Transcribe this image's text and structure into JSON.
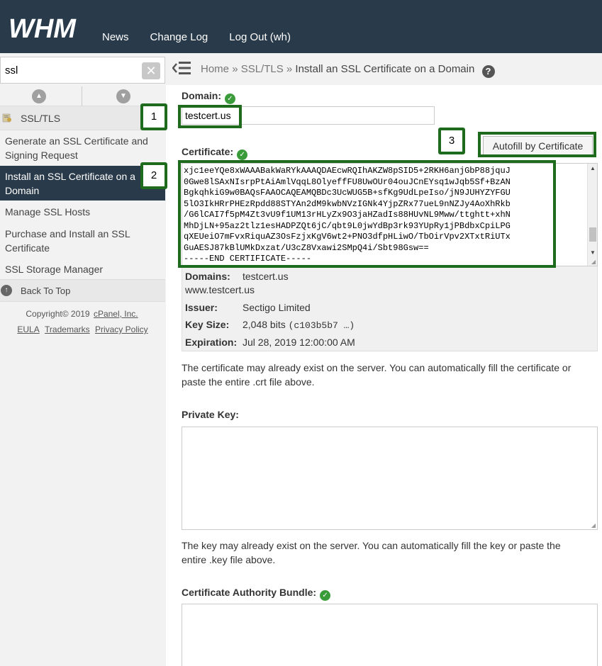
{
  "header": {
    "logo_text": "WHM",
    "nav": [
      "News",
      "Change Log",
      "Log Out (wh)"
    ]
  },
  "sidebar": {
    "search_value": "ssl",
    "category": "SSL/TLS",
    "items": [
      {
        "label": "Generate an SSL Certificate and Signing Request",
        "active": false
      },
      {
        "label": "Install an SSL Certificate on a Domain",
        "active": true
      },
      {
        "label": "Manage SSL Hosts",
        "active": false
      },
      {
        "label": "Purchase and Install an SSL Certificate",
        "active": false
      },
      {
        "label": "SSL Storage Manager",
        "active": false
      }
    ],
    "back_to_top": "Back To Top",
    "copyright_prefix": "Copyright© 2019",
    "copyright_link": "cPanel, Inc.",
    "footer_links": [
      "EULA",
      "Trademarks",
      "Privacy Policy"
    ]
  },
  "breadcrumb": {
    "home": "Home",
    "section": "SSL/TLS",
    "current": "Install an SSL Certificate on a Domain",
    "sep": "»"
  },
  "form": {
    "domain_label": "Domain:",
    "domain_value": "testcert.us",
    "autofill_label": "Autofill by Certificate",
    "cert_label": "Certificate:",
    "cert_lines": [
      "xjc1eeYQe8xWAAABakWaRYkAAAQDAEcwRQIhAKZW8pSID5+2RKH6anjGbP88jquJ",
      "0Gwe8lSAxNIsrpPtAiAmlVqqL8OlyeffFU8UwOUr04ouJCnEYsq1wJqb5Sf+BzAN",
      "BgkqhkiG9w0BAQsFAAOCAQEAMQBDc3UcWUG5B+sfKg9UdLpeIso/jN9JUHYZYFGU",
      "5lO3IkHRrPHEzRpdd88STYAn2dM9kwbNVzIGNk4YjpZRx77ueL9nNZJy4AoXhRkb",
      "/G6lCAI7f5pM4Zt3vU9f1UM13rHLyZx9O3jaHZadIs88HUvNL9Mww/ttghtt+xhN",
      "MhDjLN+95az2tlz1esHADPZQt6jC/qbt9L0jwYdBp3rk93YUpRy1jPBdbxCpiLPG",
      "qXEUeiO7mFvxRiquAZ3OsFzjxKgV6wt2+PNO3dfpHLiwO/TbOirVpv2XTxtRiUTx",
      "GuAESJ87kBlUMkDxzat/U3cZ8Vxawi2SMpQ4i/Sbt98Gsw==",
      "-----END CERTIFICATE-----"
    ],
    "details": {
      "domains_label": "Domains:",
      "domains": [
        "testcert.us",
        "www.testcert.us"
      ],
      "issuer_label": "Issuer:",
      "issuer": "Sectigo Limited",
      "keysize_label": "Key Size:",
      "keysize": "2,048 bits",
      "keysize_hash": "(c103b5b7 …)",
      "expiration_label": "Expiration:",
      "expiration": "Jul 28, 2019 12:00:00 AM"
    },
    "cert_help": "The certificate may already exist on the server. You can automatically fill the certificate or paste the entire .crt file above.",
    "key_label": "Private Key:",
    "key_help": "The key may already exist on the server. You can automatically fill the key or paste the entire .key file above.",
    "cab_label": "Certificate Authority Bundle:"
  },
  "callouts": [
    "1",
    "2",
    "3"
  ],
  "colors": {
    "header_bg": "#293a4a",
    "active_nav_bg": "#293a4a",
    "callout": "#1e6b1e",
    "check": "#3a9b3a"
  }
}
